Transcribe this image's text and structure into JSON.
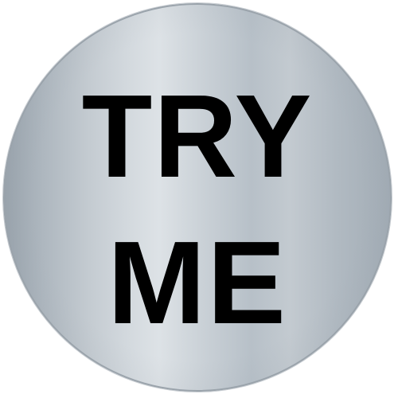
{
  "sticker": {
    "line1": "TRY",
    "line2": "ME",
    "text_color": "#000000",
    "surface_colors": [
      "#9aa4ad",
      "#dde2e6",
      "#a2acb5"
    ]
  }
}
